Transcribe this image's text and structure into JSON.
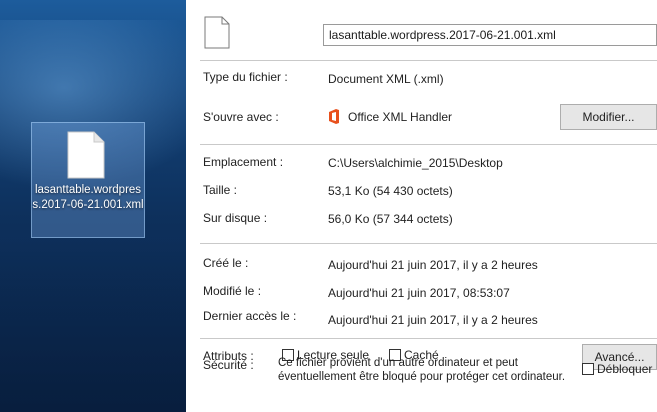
{
  "desktop": {
    "icon_label": "lasanttable.wordpress.2017-06-21.001.xml"
  },
  "panel": {
    "file_name": "lasanttable.wordpress.2017-06-21.001.xml",
    "type_label": "Type du fichier :",
    "type_value": "Document XML (.xml)",
    "opens_label": "S'ouvre avec :",
    "opens_value": "Office XML Handler",
    "modify_button": "Modifier...",
    "location_label": "Emplacement :",
    "location_value": "C:\\Users\\alchimie_2015\\Desktop",
    "size_label": "Taille :",
    "size_value": "53,1 Ko (54 430 octets)",
    "disk_label": "Sur disque :",
    "disk_value": "56,0 Ko (57 344 octets)",
    "created_label": "Créé le :",
    "created_value": "Aujourd'hui 21 juin 2017, il y a 2 heures",
    "modified_label": "Modifié le :",
    "modified_value": "Aujourd'hui 21 juin 2017, 08:53:07",
    "accessed_label": "Dernier accès le :",
    "accessed_value": "Aujourd'hui 21 juin 2017, il y a 2 heures",
    "attributes_label": "Attributs :",
    "readonly_label": "Lecture seule",
    "hidden_label": "Caché",
    "advanced_button": "Avancé...",
    "security_label": "Sécurité :",
    "security_text": "Ce fichier provient d'un autre ordinateur et peut éventuellement être bloqué pour protéger cet ordinateur.",
    "unblock_label": "Débloquer"
  }
}
